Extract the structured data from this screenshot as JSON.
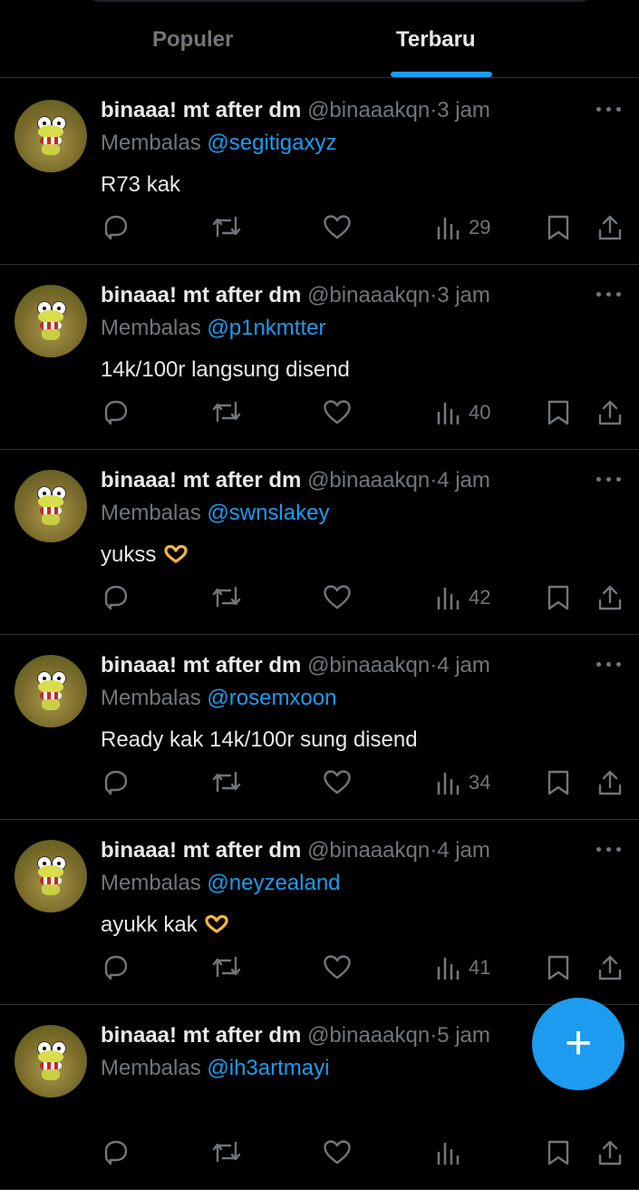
{
  "tabs": [
    {
      "label": "Populer",
      "active": false
    },
    {
      "label": "Terbaru",
      "active": true
    }
  ],
  "reply_prefix": "Membalas",
  "tweets": [
    {
      "name": "binaaa! mt after dm",
      "handle": "@binaaakqn",
      "sep": "·",
      "time": "3 jam",
      "reply_to": "@segitigaxyz",
      "text": "R73 kak",
      "emoji": "",
      "views": "29"
    },
    {
      "name": "binaaa! mt after dm",
      "handle": "@binaaakqn",
      "sep": "·",
      "time": "3 jam",
      "reply_to": "@p1nkmtter",
      "text": "14k/100r langsung disend",
      "emoji": "",
      "views": "40"
    },
    {
      "name": "binaaa! mt after dm",
      "handle": "@binaaakqn",
      "sep": "·",
      "time": "4 jam",
      "reply_to": "@swnslakey",
      "text": "yukss",
      "emoji": "heart-hands-icon",
      "views": "42"
    },
    {
      "name": "binaaa! mt after dm",
      "handle": "@binaaakqn",
      "sep": "·",
      "time": "4 jam",
      "reply_to": "@rosemxoon",
      "text": "Ready kak 14k/100r sung disend",
      "emoji": "",
      "views": "34"
    },
    {
      "name": "binaaa! mt after dm",
      "handle": "@binaaakqn",
      "sep": "·",
      "time": "4 jam",
      "reply_to": "@neyzealand",
      "text": "ayukk kak",
      "emoji": "heart-hands-icon",
      "views": "41"
    },
    {
      "name": "binaaa! mt after dm",
      "handle": "@binaaakqn",
      "sep": "·",
      "time": "5 jam",
      "reply_to": "@ih3artmayi",
      "text": "",
      "emoji": "",
      "views": ""
    }
  ],
  "fab": {
    "symbol": "+",
    "icon": "plus-icon"
  },
  "colors": {
    "background": "#000000",
    "accent": "#1d9bf0",
    "text": "#e7e9ea",
    "muted": "#71767b",
    "divider": "#2f3336"
  }
}
